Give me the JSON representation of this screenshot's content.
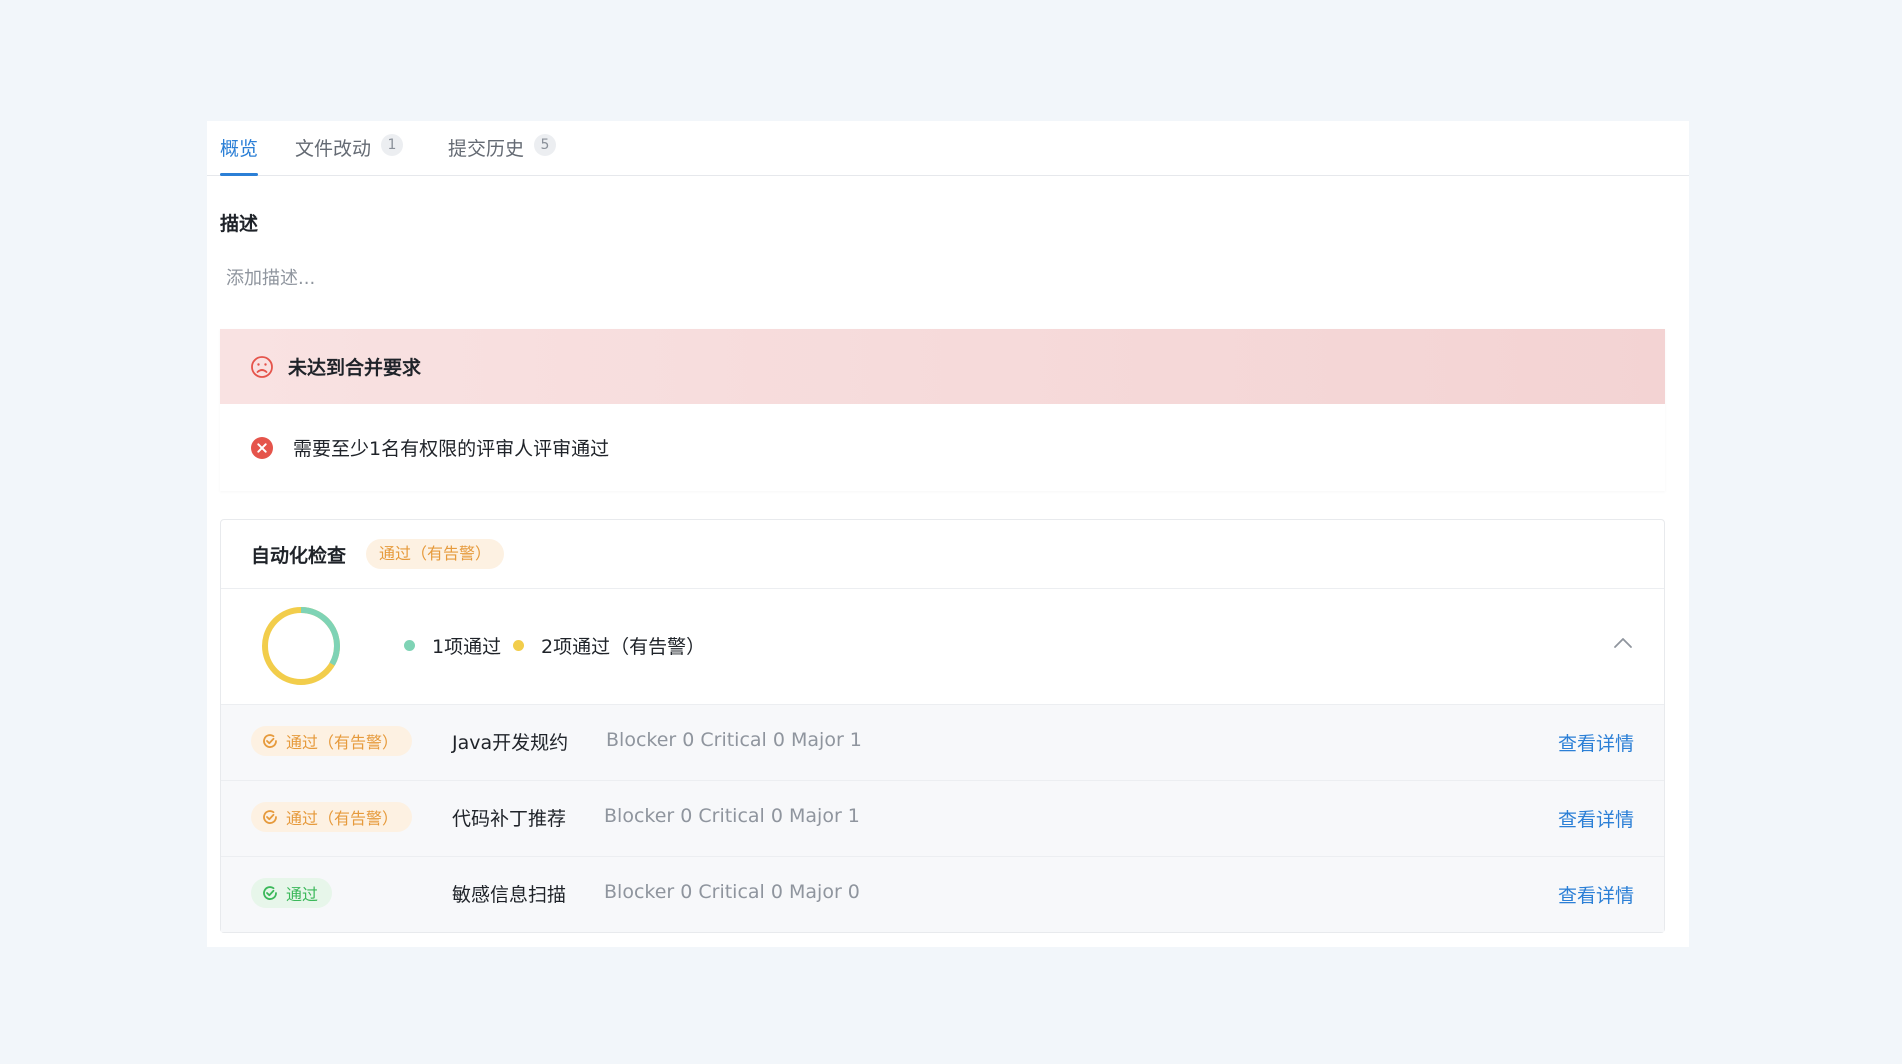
{
  "tabs": [
    {
      "label": "概览",
      "count": ""
    },
    {
      "label": "文件改动",
      "count": "1"
    },
    {
      "label": "提交历史",
      "count": "5"
    }
  ],
  "description": {
    "title": "描述",
    "placeholder": "添加描述..."
  },
  "merge_check": {
    "title": "未达到合并要求",
    "items": [
      {
        "text": "需要至少1名有权限的评审人评审通过"
      }
    ],
    "colors": {
      "error": "#e5544b"
    }
  },
  "automation": {
    "title": "自动化检查",
    "badge": "通过（有告警）",
    "summary": {
      "passed": 1,
      "passed_label": "1项通过",
      "warned": 2,
      "warned_label": "2项通过（有告警）",
      "colors": {
        "passed": "#7fd3b5",
        "warned": "#f2cd4b"
      }
    },
    "rows": [
      {
        "status": "warn",
        "status_label": "通过（有告警）",
        "name": "Java开发规约",
        "metrics": "Blocker 0 Critical 0 Major 1",
        "link": "查看详情"
      },
      {
        "status": "warn",
        "status_label": "通过（有告警）",
        "name": "代码补丁推荐",
        "metrics": "Blocker 0 Critical 0 Major 1",
        "link": "查看详情"
      },
      {
        "status": "pass",
        "status_label": "通过",
        "name": "敏感信息扫描",
        "metrics": "Blocker 0 Critical 0 Major 0",
        "link": "查看详情"
      }
    ]
  }
}
